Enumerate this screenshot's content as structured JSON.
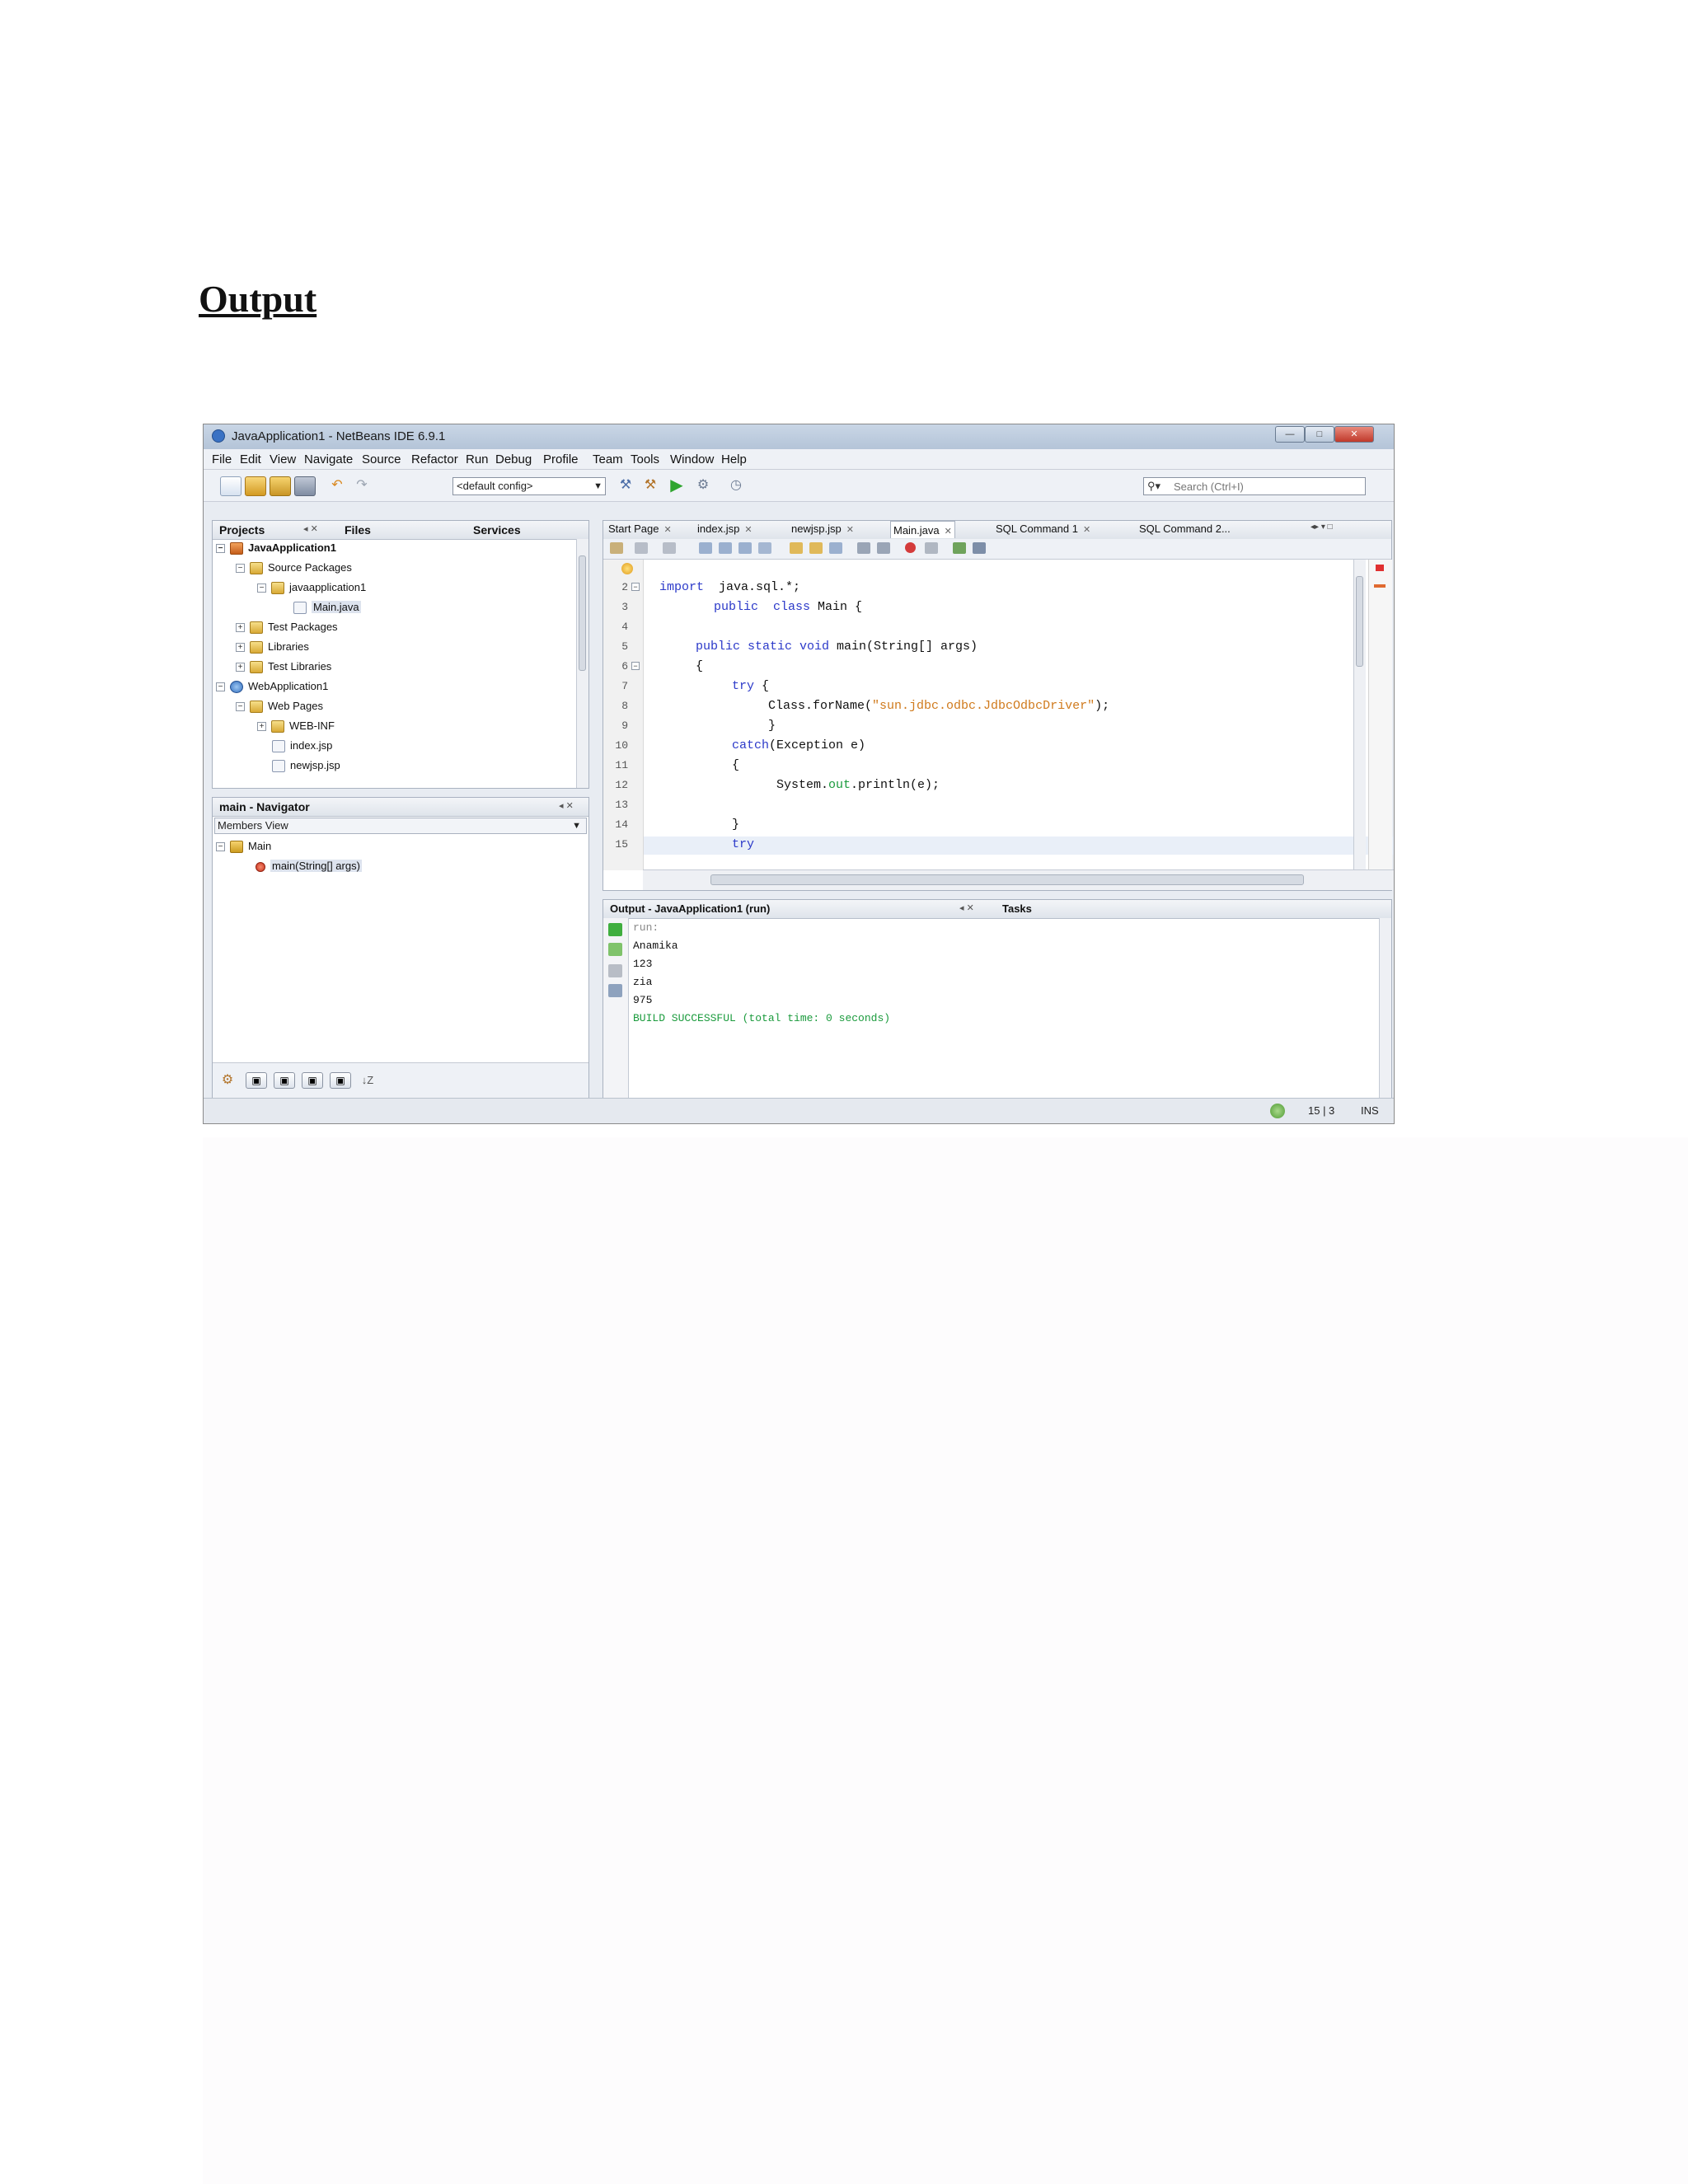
{
  "page": {
    "heading": "Output"
  },
  "window": {
    "title": "JavaApplication1 - NetBeans IDE 6.9.1",
    "controls": {
      "minimize": "—",
      "maximize": "□",
      "close": "✕"
    }
  },
  "menu": [
    "File",
    "Edit",
    "View",
    "Navigate",
    "Source",
    "Refactor",
    "Run",
    "Debug",
    "Profile",
    "Team",
    "Tools",
    "Window",
    "Help"
  ],
  "toolbar": {
    "config": "<default config>",
    "search_placeholder": "Search (Ctrl+I)"
  },
  "projects_panel": {
    "tabs": [
      "Projects",
      "Files",
      "Services"
    ],
    "tree": [
      {
        "label": "JavaApplication1",
        "bold": true
      },
      {
        "label": "Source Packages"
      },
      {
        "label": "javaapplication1"
      },
      {
        "label": "Main.java"
      },
      {
        "label": "Test Packages"
      },
      {
        "label": "Libraries"
      },
      {
        "label": "Test Libraries"
      },
      {
        "label": "WebApplication1"
      },
      {
        "label": "Web Pages"
      },
      {
        "label": "WEB-INF"
      },
      {
        "label": "index.jsp"
      },
      {
        "label": "newjsp.jsp"
      }
    ]
  },
  "navigator": {
    "title": "main - Navigator",
    "view": "Members View",
    "items": [
      "Main",
      "main(String[] args)"
    ]
  },
  "editor": {
    "tabs": [
      "Start Page",
      "index.jsp",
      "newjsp.jsp",
      "Main.java",
      "SQL Command 1",
      "SQL Command 2..."
    ],
    "active_tab": "Main.java",
    "line_numbers": [
      "2",
      "3",
      "4",
      "5",
      "6",
      "7",
      "8",
      "9",
      "10",
      "11",
      "12",
      "13",
      "14",
      "15"
    ],
    "code": {
      "l2a": "import",
      "l2b": "  java.sql.*;",
      "l3a": "public",
      "l3b": "  class",
      "l3c": " Main {",
      "l5a": "public static void",
      "l5b": " main(String[] args)",
      "l6": "{",
      "l7a": "try",
      "l7b": " {",
      "l8a": "Class.forName(",
      "l8b": "\"sun.jdbc.odbc.JdbcOdbcDriver\"",
      "l8c": ");",
      "l9": "}",
      "l10a": "catch",
      "l10b": "(Exception e)",
      "l11": "{",
      "l12a": "System.",
      "l12b": "out",
      "l12c": ".println(e);",
      "l14": "}",
      "l15": "try"
    }
  },
  "output": {
    "title": "Output - JavaApplication1 (run)",
    "tasks_tab": "Tasks",
    "lines": [
      "run:",
      "Anamika",
      "123",
      "zia",
      "975",
      "BUILD SUCCESSFUL (total time: 0 seconds)"
    ]
  },
  "status": {
    "position": "15 | 3",
    "mode": "INS"
  },
  "colors": {
    "keyword": "#2b39c9",
    "string": "#d07a1c",
    "success": "#1b9b3d"
  }
}
